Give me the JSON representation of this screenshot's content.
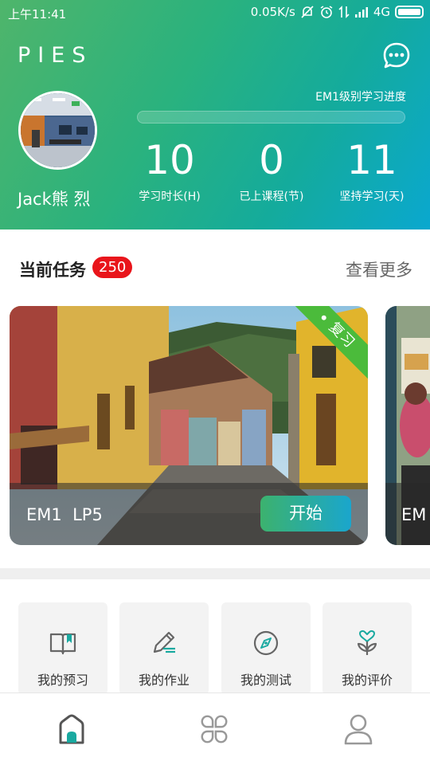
{
  "status_bar": {
    "time": "上午11:41",
    "network_speed": "0.05K/s",
    "network_type": "4G"
  },
  "header": {
    "logo": "PIES",
    "chat_icon": "chat-bubble-icon",
    "username": "Jack熊 烈",
    "progress_label": "EM1级别学习进度",
    "progress_fraction": 0.0,
    "stats": [
      {
        "value": "10",
        "label": "学习时长(H)"
      },
      {
        "value": "0",
        "label": "已上课程(节)"
      },
      {
        "value": "11",
        "label": "坚持学习(天)"
      }
    ]
  },
  "tasks": {
    "title": "当前任务",
    "count": "250",
    "see_more": "查看更多",
    "cards": [
      {
        "lesson": "EM1  LP5",
        "ribbon": "复习",
        "start_label": "开始"
      },
      {
        "lesson": "EM"
      }
    ]
  },
  "tiles": [
    {
      "label": "我的预习",
      "icon": "open-book-icon"
    },
    {
      "label": "我的作业",
      "icon": "pencil-icon"
    },
    {
      "label": "我的测试",
      "icon": "compass-icon"
    },
    {
      "label": "我的评价",
      "icon": "heart-plant-icon"
    }
  ],
  "nav": [
    {
      "icon": "home-icon",
      "active": true
    },
    {
      "icon": "apps-icon",
      "active": false
    },
    {
      "icon": "user-icon",
      "active": false
    }
  ],
  "colors": {
    "gradient_start": "#4fb56b",
    "gradient_end": "#0aa8cf",
    "badge": "#e9151b",
    "ribbon": "#4bbb3b",
    "accent_teal": "#19a9a0"
  }
}
